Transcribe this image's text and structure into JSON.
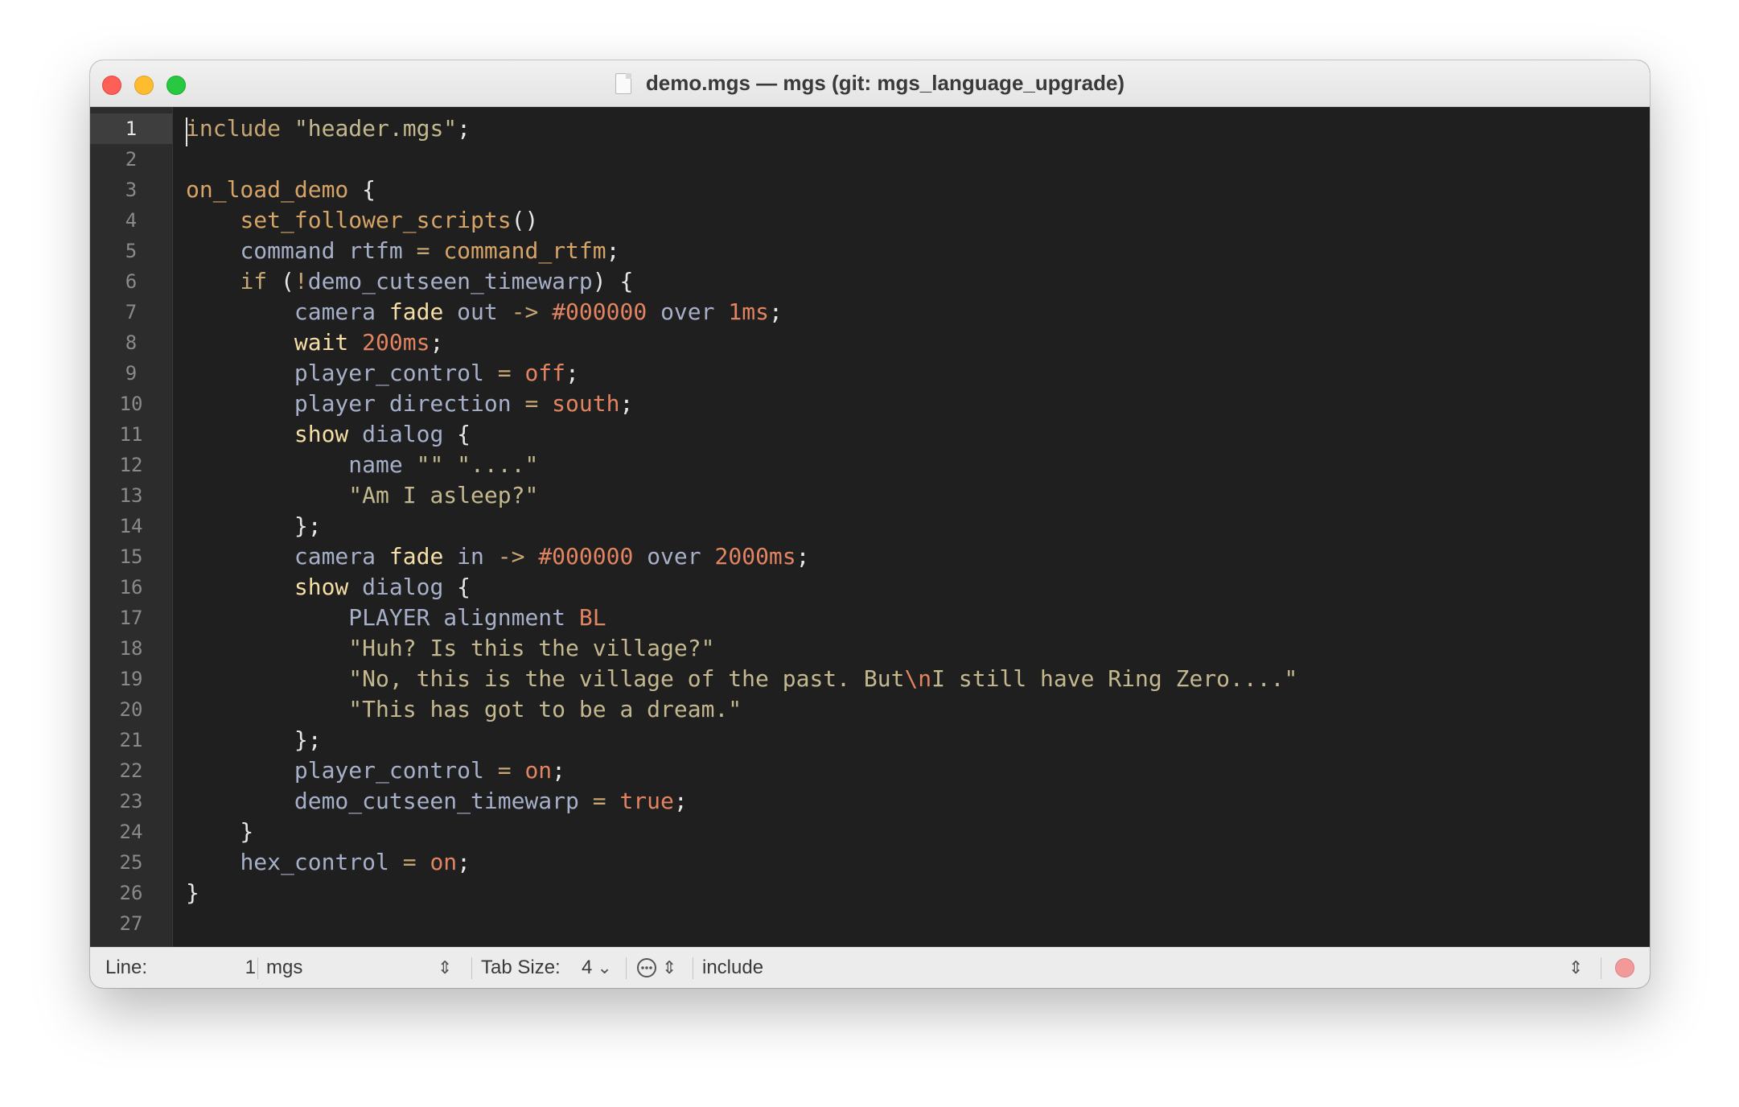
{
  "window": {
    "title": "demo.mgs — mgs (git: mgs_language_upgrade)"
  },
  "editor": {
    "current_line": 1,
    "line_numbers": [
      "1",
      "2",
      "3",
      "4",
      "5",
      "6",
      "7",
      "8",
      "9",
      "10",
      "11",
      "12",
      "13",
      "14",
      "15",
      "16",
      "17",
      "18",
      "19",
      "20",
      "21",
      "22",
      "23",
      "24",
      "25",
      "26",
      "27"
    ],
    "lines": [
      [
        [
          "kw",
          "include"
        ],
        [
          "pun",
          " "
        ],
        [
          "str",
          "\"header.mgs\""
        ],
        [
          "pun",
          ";"
        ]
      ],
      [],
      [
        [
          "fn",
          "on_load_demo"
        ],
        [
          "pun",
          " {"
        ]
      ],
      [
        [
          "pun",
          "    "
        ],
        [
          "fn",
          "set_follower_scripts"
        ],
        [
          "pun",
          "()"
        ]
      ],
      [
        [
          "pun",
          "    "
        ],
        [
          "var",
          "command"
        ],
        [
          "pun",
          " "
        ],
        [
          "var",
          "rtfm"
        ],
        [
          "pun",
          " "
        ],
        [
          "kw",
          "="
        ],
        [
          "pun",
          " "
        ],
        [
          "fn",
          "command_rtfm"
        ],
        [
          "pun",
          ";"
        ]
      ],
      [
        [
          "pun",
          "    "
        ],
        [
          "kw",
          "if"
        ],
        [
          "pun",
          " ("
        ],
        [
          "kw",
          "!"
        ],
        [
          "var",
          "demo_cutseen_timewarp"
        ],
        [
          "pun",
          ") {"
        ]
      ],
      [
        [
          "pun",
          "        "
        ],
        [
          "var",
          "camera"
        ],
        [
          "pun",
          " "
        ],
        [
          "cmd",
          "fade"
        ],
        [
          "pun",
          " "
        ],
        [
          "var",
          "out"
        ],
        [
          "pun",
          " "
        ],
        [
          "kw",
          "->"
        ],
        [
          "pun",
          " "
        ],
        [
          "num",
          "#000000"
        ],
        [
          "pun",
          " "
        ],
        [
          "var",
          "over"
        ],
        [
          "pun",
          " "
        ],
        [
          "num",
          "1ms"
        ],
        [
          "pun",
          ";"
        ]
      ],
      [
        [
          "pun",
          "        "
        ],
        [
          "cmd",
          "wait"
        ],
        [
          "pun",
          " "
        ],
        [
          "num",
          "200ms"
        ],
        [
          "pun",
          ";"
        ]
      ],
      [
        [
          "pun",
          "        "
        ],
        [
          "var",
          "player_control"
        ],
        [
          "pun",
          " "
        ],
        [
          "kw",
          "="
        ],
        [
          "pun",
          " "
        ],
        [
          "num",
          "off"
        ],
        [
          "pun",
          ";"
        ]
      ],
      [
        [
          "pun",
          "        "
        ],
        [
          "var",
          "player direction"
        ],
        [
          "pun",
          " "
        ],
        [
          "kw",
          "="
        ],
        [
          "pun",
          " "
        ],
        [
          "num",
          "south"
        ],
        [
          "pun",
          ";"
        ]
      ],
      [
        [
          "pun",
          "        "
        ],
        [
          "cmd",
          "show"
        ],
        [
          "pun",
          " "
        ],
        [
          "var",
          "dialog"
        ],
        [
          "pun",
          " {"
        ]
      ],
      [
        [
          "pun",
          "            "
        ],
        [
          "var",
          "name"
        ],
        [
          "pun",
          " "
        ],
        [
          "str",
          "\"\""
        ],
        [
          "pun",
          " "
        ],
        [
          "str",
          "\"....\""
        ]
      ],
      [
        [
          "pun",
          "            "
        ],
        [
          "str",
          "\"Am I asleep?\""
        ]
      ],
      [
        [
          "pun",
          "        };"
        ]
      ],
      [
        [
          "pun",
          "        "
        ],
        [
          "var",
          "camera"
        ],
        [
          "pun",
          " "
        ],
        [
          "cmd",
          "fade"
        ],
        [
          "pun",
          " "
        ],
        [
          "var",
          "in"
        ],
        [
          "pun",
          " "
        ],
        [
          "kw",
          "->"
        ],
        [
          "pun",
          " "
        ],
        [
          "num",
          "#000000"
        ],
        [
          "pun",
          " "
        ],
        [
          "var",
          "over"
        ],
        [
          "pun",
          " "
        ],
        [
          "num",
          "2000ms"
        ],
        [
          "pun",
          ";"
        ]
      ],
      [
        [
          "pun",
          "        "
        ],
        [
          "cmd",
          "show"
        ],
        [
          "pun",
          " "
        ],
        [
          "var",
          "dialog"
        ],
        [
          "pun",
          " {"
        ]
      ],
      [
        [
          "pun",
          "            "
        ],
        [
          "var",
          "PLAYER alignment"
        ],
        [
          "pun",
          " "
        ],
        [
          "num",
          "BL"
        ]
      ],
      [
        [
          "pun",
          "            "
        ],
        [
          "str",
          "\"Huh? Is this the village?\""
        ]
      ],
      [
        [
          "pun",
          "            "
        ],
        [
          "str",
          "\"No, this is the village of the past. But"
        ],
        [
          "esc",
          "\\n"
        ],
        [
          "str",
          "I still have Ring Zero....\""
        ]
      ],
      [
        [
          "pun",
          "            "
        ],
        [
          "str",
          "\"This has got to be a dream.\""
        ]
      ],
      [
        [
          "pun",
          "        };"
        ]
      ],
      [
        [
          "pun",
          "        "
        ],
        [
          "var",
          "player_control"
        ],
        [
          "pun",
          " "
        ],
        [
          "kw",
          "="
        ],
        [
          "pun",
          " "
        ],
        [
          "num",
          "on"
        ],
        [
          "pun",
          ";"
        ]
      ],
      [
        [
          "pun",
          "        "
        ],
        [
          "var",
          "demo_cutseen_timewarp"
        ],
        [
          "pun",
          " "
        ],
        [
          "kw",
          "="
        ],
        [
          "pun",
          " "
        ],
        [
          "num",
          "true"
        ],
        [
          "pun",
          ";"
        ]
      ],
      [
        [
          "pun",
          "    }"
        ]
      ],
      [
        [
          "pun",
          "    "
        ],
        [
          "var",
          "hex_control"
        ],
        [
          "pun",
          " "
        ],
        [
          "kw",
          "="
        ],
        [
          "pun",
          " "
        ],
        [
          "num",
          "on"
        ],
        [
          "pun",
          ";"
        ]
      ],
      [
        [
          "pun",
          "}"
        ]
      ],
      []
    ]
  },
  "statusbar": {
    "line_label": "Line:",
    "line_value": "1",
    "language": "mgs",
    "tab_size_label": "Tab Size:",
    "tab_size_value": "4",
    "symbol": "include"
  },
  "icons": {
    "settings": "ellipsis-circle-icon",
    "updown": "chevron-up-down-icon",
    "record": "record-dot-icon"
  },
  "colors": {
    "background": "#1f1f1f",
    "gutter": "#2c2c2c",
    "keyword": "#c5a674",
    "function": "#d6a467",
    "variable": "#a7b0c9",
    "string": "#c4b88f",
    "number": "#e28461",
    "command": "#f5dfa6"
  }
}
